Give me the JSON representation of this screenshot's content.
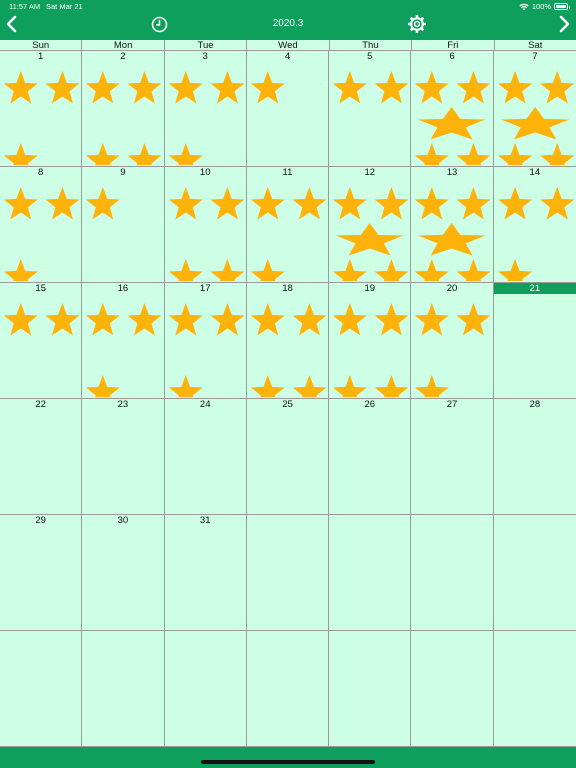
{
  "status_bar": {
    "time": "11:57 AM",
    "date": "Sat Mar 21",
    "battery": "100%"
  },
  "header": {
    "title": "2020.3",
    "prev_icon": "chevron-left-icon",
    "next_icon": "chevron-right-icon",
    "history_icon": "clock-icon",
    "settings_icon": "gear-icon"
  },
  "colors": {
    "brand": "#0e9f5c",
    "background": "#ccffe5",
    "star": "#ffb20a"
  },
  "weekdays": [
    "Sun",
    "Mon",
    "Tue",
    "Wed",
    "Thu",
    "Fri",
    "Sat"
  ],
  "today": "21",
  "days": [
    {
      "d": "1",
      "stars": [
        "s",
        "s",
        "s"
      ]
    },
    {
      "d": "2",
      "stars": [
        "s",
        "s",
        "s",
        "s",
        "s"
      ]
    },
    {
      "d": "3",
      "stars": [
        "s",
        "s",
        "s"
      ]
    },
    {
      "d": "4",
      "stars": [
        "s"
      ]
    },
    {
      "d": "5",
      "stars": [
        "s",
        "s"
      ]
    },
    {
      "d": "6",
      "stars": [
        "s",
        "s",
        "L",
        "s",
        "s"
      ]
    },
    {
      "d": "7",
      "stars": [
        "s",
        "s",
        "L",
        "s",
        "s"
      ]
    },
    {
      "d": "8",
      "stars": [
        "s",
        "s",
        "s"
      ]
    },
    {
      "d": "9",
      "stars": [
        "s"
      ]
    },
    {
      "d": "10",
      "stars": [
        "s",
        "s",
        "s",
        "s"
      ]
    },
    {
      "d": "11",
      "stars": [
        "s",
        "s",
        "s"
      ]
    },
    {
      "d": "12",
      "stars": [
        "s",
        "s",
        "L",
        "s",
        "s"
      ]
    },
    {
      "d": "13",
      "stars": [
        "s",
        "s",
        "L",
        "s",
        "s"
      ]
    },
    {
      "d": "14",
      "stars": [
        "s",
        "s",
        "s"
      ]
    },
    {
      "d": "15",
      "stars": [
        "s",
        "s"
      ]
    },
    {
      "d": "16",
      "stars": [
        "s",
        "s",
        "s"
      ]
    },
    {
      "d": "17",
      "stars": [
        "s",
        "s",
        "s"
      ]
    },
    {
      "d": "18",
      "stars": [
        "s",
        "s",
        "s",
        "s"
      ]
    },
    {
      "d": "19",
      "stars": [
        "s",
        "s",
        "s",
        "s"
      ]
    },
    {
      "d": "20",
      "stars": [
        "s",
        "s",
        "s"
      ]
    },
    {
      "d": "21",
      "stars": []
    },
    {
      "d": "22",
      "stars": []
    },
    {
      "d": "23",
      "stars": []
    },
    {
      "d": "24",
      "stars": []
    },
    {
      "d": "25",
      "stars": []
    },
    {
      "d": "26",
      "stars": []
    },
    {
      "d": "27",
      "stars": []
    },
    {
      "d": "28",
      "stars": []
    },
    {
      "d": "29",
      "stars": []
    },
    {
      "d": "30",
      "stars": []
    },
    {
      "d": "31",
      "stars": []
    },
    {
      "d": "",
      "stars": []
    },
    {
      "d": "",
      "stars": []
    },
    {
      "d": "",
      "stars": []
    },
    {
      "d": "",
      "stars": []
    },
    {
      "d": "",
      "stars": []
    },
    {
      "d": "",
      "stars": []
    },
    {
      "d": "",
      "stars": []
    },
    {
      "d": "",
      "stars": []
    },
    {
      "d": "",
      "stars": []
    },
    {
      "d": "",
      "stars": []
    },
    {
      "d": "",
      "stars": []
    }
  ]
}
